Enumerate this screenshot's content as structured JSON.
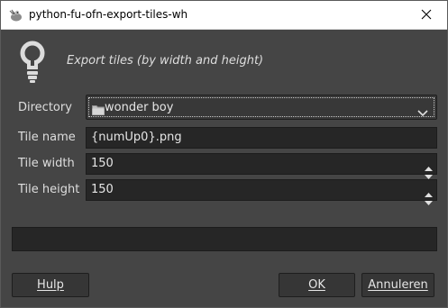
{
  "window": {
    "title": "python-fu-ofn-export-tiles-wh",
    "app_icon": "gimp-wilber-icon",
    "close_icon": "close-icon"
  },
  "header": {
    "icon": "lightbulb-icon",
    "description": "Export tiles (by width and height)"
  },
  "form": {
    "directory": {
      "label": "Directory",
      "value": "wonder boy",
      "icon": "folder-icon",
      "arrow_icon": "chevron-down-icon"
    },
    "tile_name": {
      "label": "Tile name",
      "value": "{numUp0}.png"
    },
    "tile_width": {
      "label": "Tile width",
      "value": "150"
    },
    "tile_height": {
      "label": "Tile height",
      "value": "150"
    }
  },
  "progress": {
    "fraction": 0
  },
  "buttons": {
    "help": "Hulp",
    "ok": "OK",
    "cancel": "Annuleren"
  },
  "colors": {
    "background": "#454545",
    "entry_background": "#262626",
    "text": "#dedede"
  }
}
